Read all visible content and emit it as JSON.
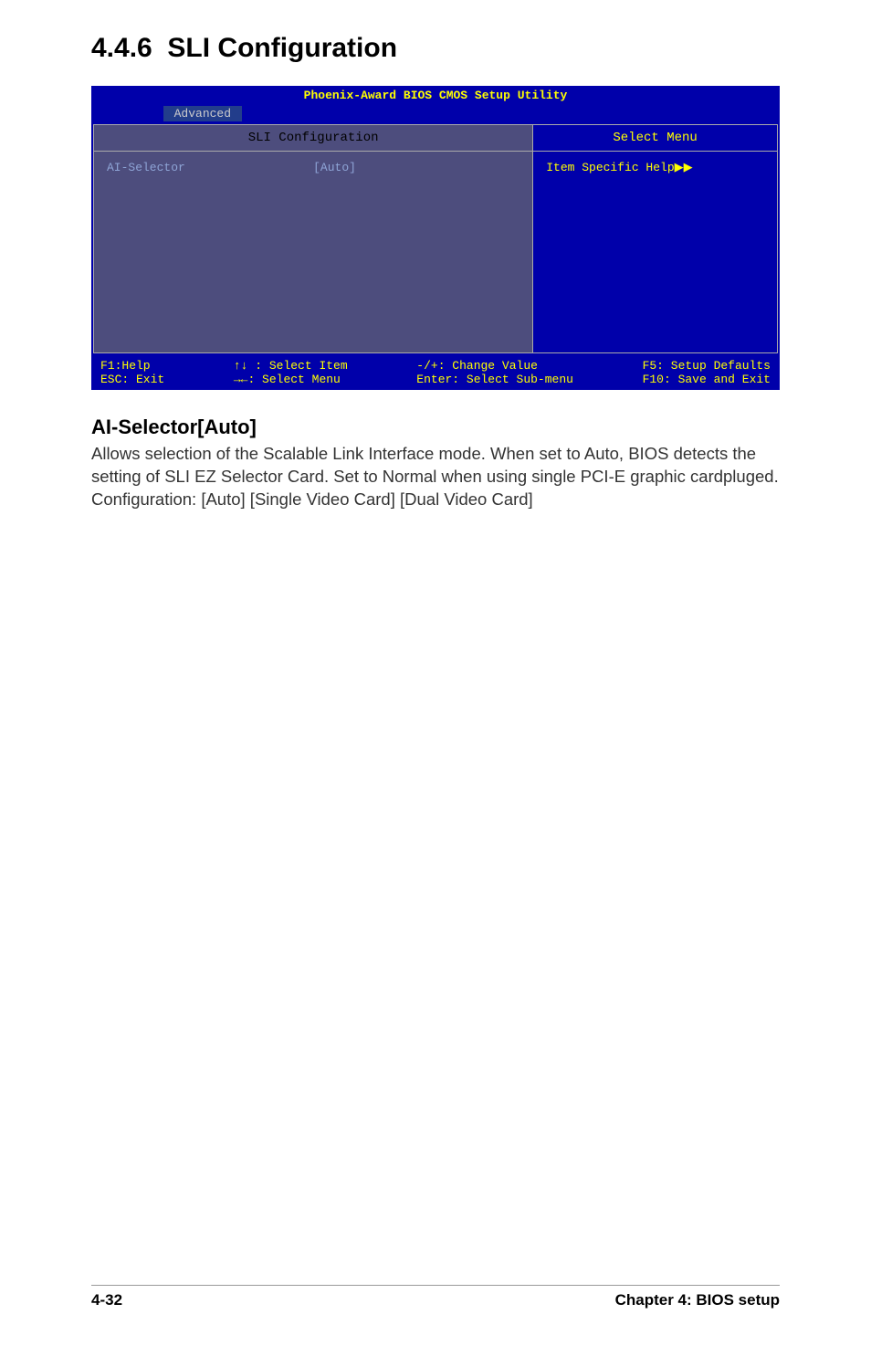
{
  "section": {
    "number": "4.4.6",
    "title": "SLI Configuration"
  },
  "bios": {
    "title": "Phoenix-Award BIOS CMOS Setup Utility",
    "menu": {
      "active": "Advanced"
    },
    "left_panel": {
      "header": "SLI Configuration",
      "items": [
        {
          "label": "AI-Selector",
          "value": "[Auto]"
        }
      ]
    },
    "right_panel": {
      "header": "Select Menu",
      "help": "Item Specific Help▶▶"
    },
    "footer": {
      "col1_line1": "F1:Help",
      "col1_line2": "ESC: Exit",
      "col2_line1": "↑↓ : Select Item",
      "col2_line2": "→←: Select Menu",
      "col3_line1": "-/+: Change Value",
      "col3_line2": "Enter: Select Sub-menu",
      "col4_line1": "F5: Setup Defaults",
      "col4_line2": "F10: Save and Exit"
    }
  },
  "body": {
    "heading": "AI-Selector[Auto]",
    "paragraph1": "Allows selection of the Scalable Link Interface mode. When set to Auto, BIOS detects the setting of SLI EZ Selector Card. Set to Normal when using single PCI-E graphic cardpluged.",
    "paragraph2": "Configuration: [Auto] [Single Video Card] [Dual Video Card]"
  },
  "footer": {
    "page": "4-32",
    "chapter": "Chapter 4: BIOS setup"
  }
}
